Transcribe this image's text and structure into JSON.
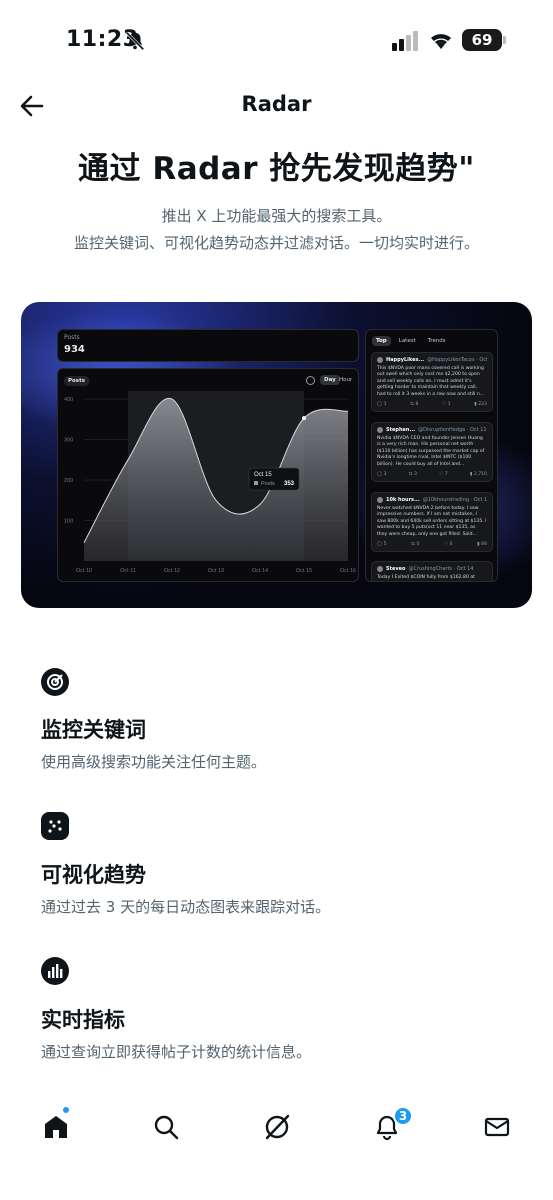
{
  "status_bar": {
    "time": "11:23",
    "battery": "69"
  },
  "header": {
    "title": "Radar"
  },
  "hero": {
    "title": "通过 Radar 抢先发现趋势\"",
    "subtitle_line1": "推出 X 上功能最强大的搜索工具。",
    "subtitle_line2": "监控关键词、可视化趋势动态并过滤对话。一切均实时进行。"
  },
  "preview": {
    "posts_label": "Posts",
    "posts_value": "934",
    "chart_chip": "Posts",
    "range_day": "Day",
    "range_hour": "Hour",
    "tooltip_date": "Oct 15",
    "tooltip_label": "Posts",
    "tooltip_value": "353",
    "feed_tabs": [
      "Top",
      "Latest",
      "Trends"
    ],
    "chart_data": {
      "type": "area",
      "x": [
        "Oct 10",
        "Oct 11",
        "Oct 12",
        "Oct 13",
        "Oct 14",
        "Oct 15",
        "Oct 16"
      ],
      "values": [
        45,
        250,
        400,
        150,
        140,
        353,
        370
      ],
      "y_ticks": [
        "400",
        "300",
        "200",
        "100"
      ],
      "ylim": [
        0,
        420
      ],
      "highlight_range": [
        "Oct 11",
        "Oct 15"
      ]
    },
    "tweets": [
      {
        "name": "HappyLikes...",
        "handle": "@HappyLikesTacos · Oct 14",
        "text": "This $NVDA poor mans covered call is working out swell which only cost me $2,200 to open and sell weekly calls on. I must admit it's getting harder to maintain that weekly call, had to roll it 3 weeks in a row now and still n...",
        "stats": [
          "1",
          "8",
          "1",
          "223"
        ]
      },
      {
        "name": "Stephen...",
        "handle": "@DisruptionHedge · Oct 11",
        "text": "Nvidia $NVDA CEO and founder Jensen Huang is a very rich man. His personal net worth ($110 billion) has surpassed the market cap of Nvidia's longtime rival, Intel $INTC ($100 billion). He could buy all of Intel and...",
        "stats": [
          "3",
          "3",
          "7",
          "2,710"
        ]
      },
      {
        "name": "10k hours...",
        "handle": "@10khourstrading · Oct 11",
        "text": "Never watched $NVDA 2 before today. I saw impressive numbers. If I am not mistaken, I saw 800k and 640k sell orders sitting at $135. I wanted to buy 5 puts(oct 11 near $135, as they were cheap, only one got filled. Sold...",
        "stats": [
          "5",
          "0",
          "6",
          "86"
        ]
      },
      {
        "name": "Steveo",
        "handle": "@CrushingCharts · Oct 14",
        "text": "Today I Exited $COIN fully from $162.80 at",
        "stats": []
      }
    ]
  },
  "features": [
    {
      "icon": "target-icon",
      "title": "监控关键词",
      "desc": "使用高级搜索功能关注任何主题。"
    },
    {
      "icon": "scatter-chart-icon",
      "title": "可视化趋势",
      "desc": "通过过去 3 天的每日动态图表来跟踪对话。"
    },
    {
      "icon": "bar-chart-icon",
      "title": "实时指标",
      "desc": "通过查询立即获得帖子计数的统计信息。"
    }
  ],
  "bottom_nav": {
    "notifications_badge": "3"
  }
}
